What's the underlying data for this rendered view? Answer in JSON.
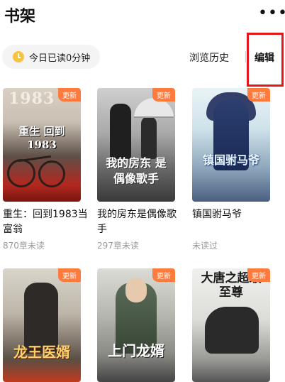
{
  "header": {
    "title": "书架",
    "more_label": "•••"
  },
  "toolbar": {
    "reading_time": "今日已读0分钟",
    "history_label": "浏览历史",
    "edit_label": "编辑"
  },
  "badge_label": "更新",
  "books": [
    {
      "name": "重生：回到1983当富翁",
      "status": "870章未读",
      "cover_title": "重生 回到1983",
      "cover_top": "1983"
    },
    {
      "name": "我的房东是偶像歌手",
      "status": "297章未读",
      "cover_title": "我的房东 是偶像歌手"
    },
    {
      "name": "镇国驸马爷",
      "status": "未读过",
      "cover_title": "镇国驸马爷"
    },
    {
      "cover_title": "龙王医婿"
    },
    {
      "cover_title": "上门龙婿"
    },
    {
      "cover_title": "大唐之超级至尊"
    }
  ],
  "colors": {
    "badge": "#ff7a3d",
    "highlight_box": "#e3161a"
  }
}
